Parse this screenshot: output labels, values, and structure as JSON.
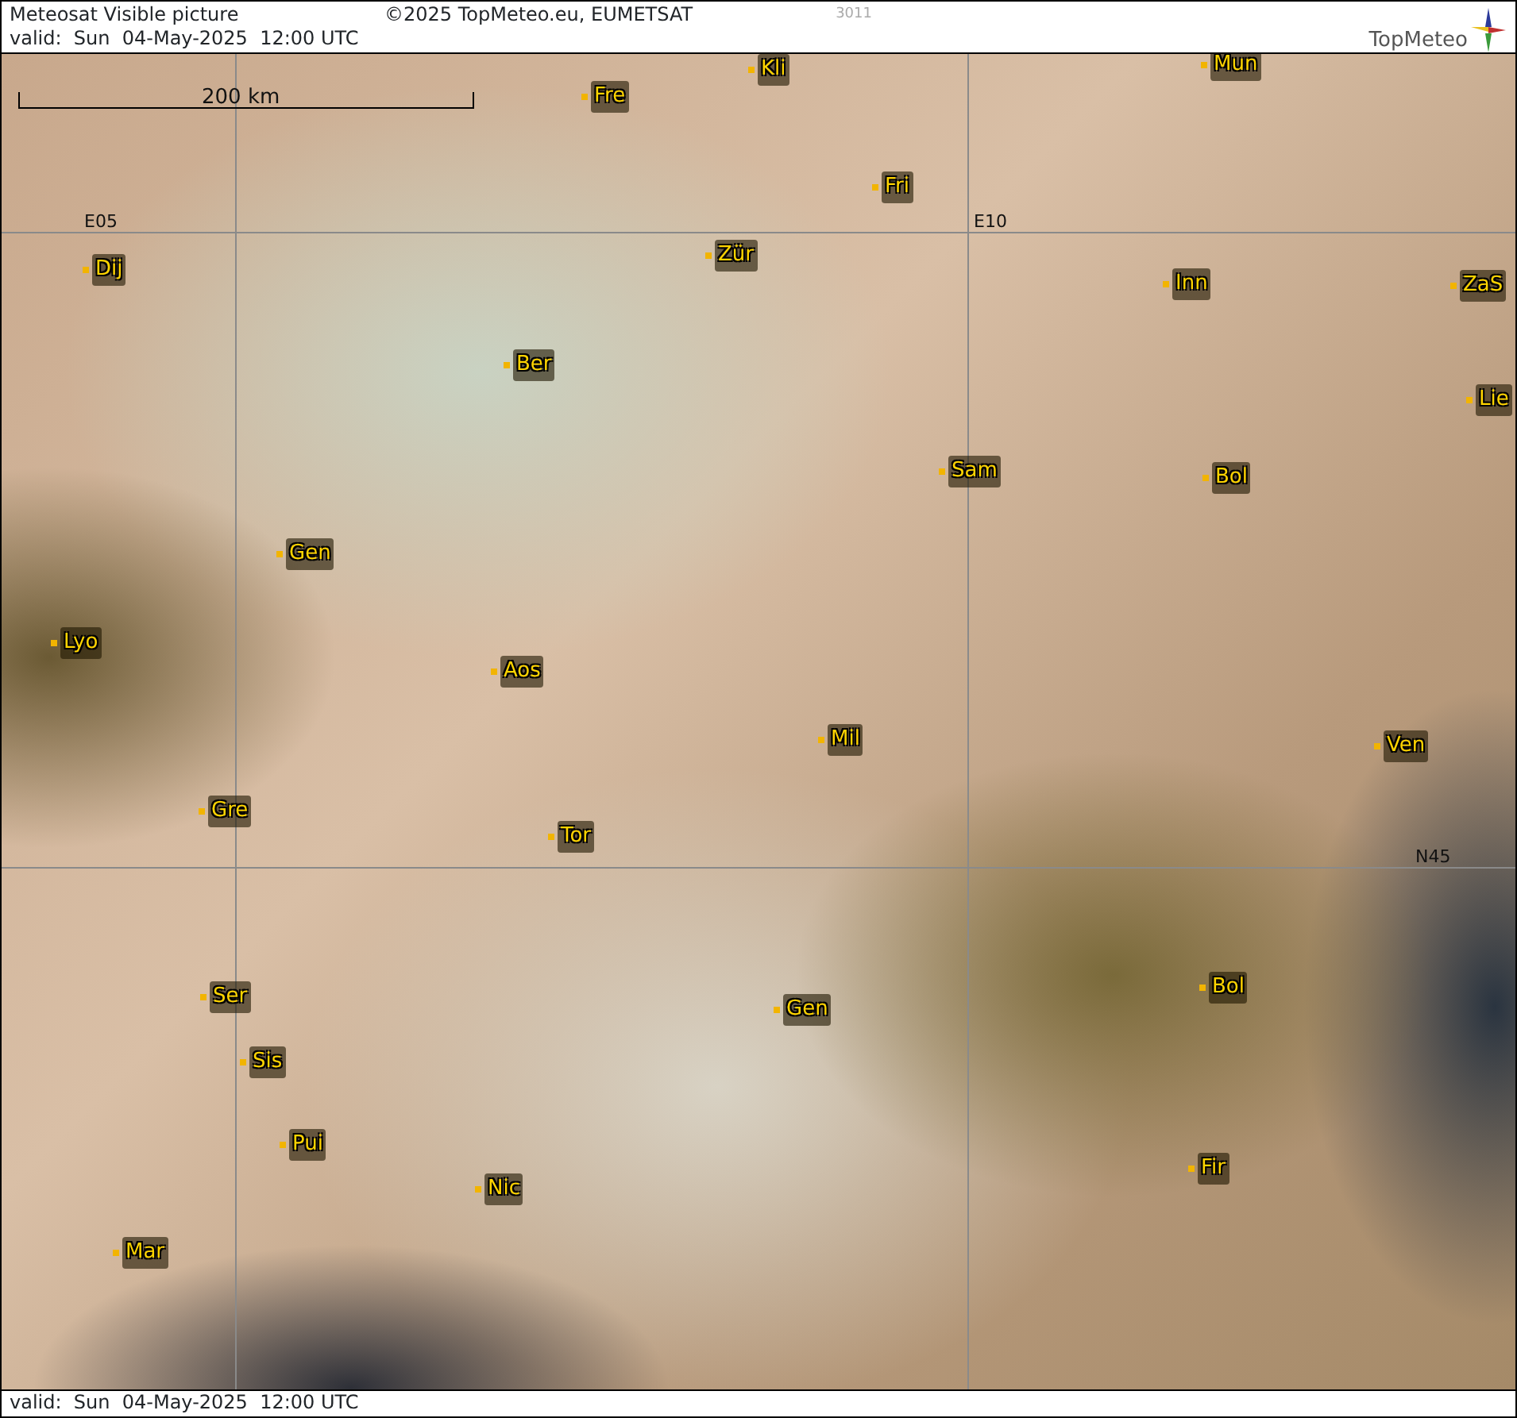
{
  "header": {
    "title": "Meteosat Visible picture",
    "copyright": "©2025 TopMeteo.eu, EUMETSAT",
    "code": "3011",
    "valid": "valid:  Sun  04-May-2025  12:00 UTC",
    "logo": "TopMeteo"
  },
  "map": {
    "scale": "200 km",
    "grid_labels": [
      "E05",
      "E10",
      "N45"
    ],
    "places": [
      "Kli",
      "Mun",
      "Fre",
      "Fri",
      "Dij",
      "Zür",
      "Inn",
      "ZaS",
      "Ber",
      "Lie",
      "Sam",
      "Bol",
      "Gen",
      "Lyo",
      "Aos",
      "Mil",
      "Ven",
      "Gre",
      "Tor",
      "Ser",
      "Bol",
      "Gen",
      "Sis",
      "Pui",
      "Fir",
      "Nic",
      "Mar"
    ]
  },
  "footer": {
    "valid": "valid:  Sun  04-May-2025  12:00 UTC"
  }
}
